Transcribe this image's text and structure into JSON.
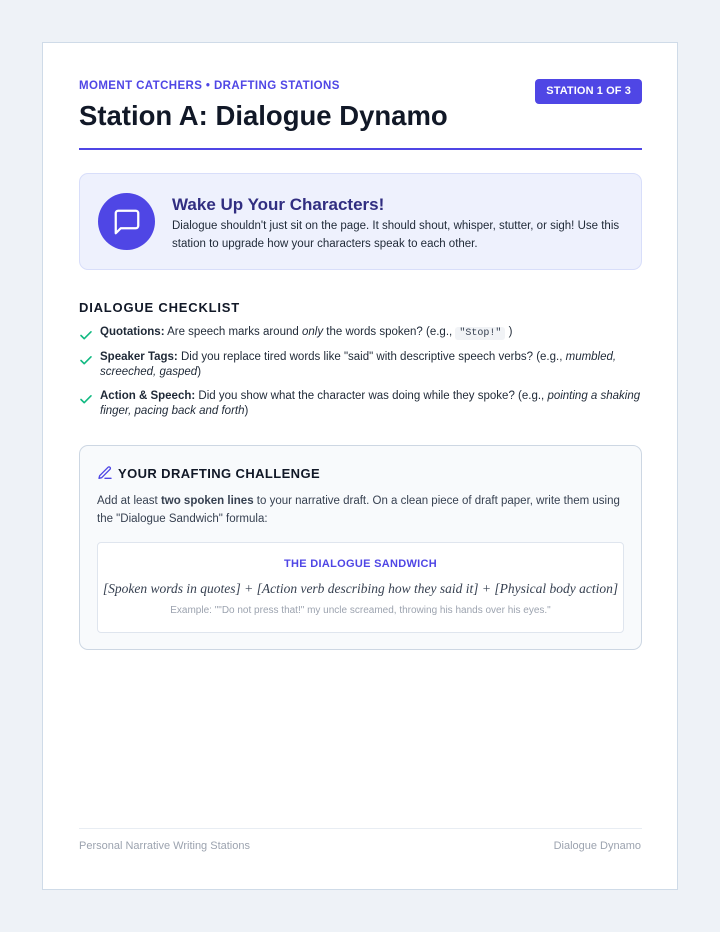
{
  "header": {
    "eyebrow": "MOMENT CATCHERS • DRAFTING STATIONS",
    "badge": "STATION 1 OF 3",
    "title": "Station A: Dialogue Dynamo"
  },
  "callout": {
    "icon": "speech-bubble-icon",
    "title": "Wake Up Your Characters!",
    "text": "Dialogue shouldn't just sit on the page. It should shout, whisper, stutter, or sigh! Use this station to upgrade how your characters speak to each other."
  },
  "checklist": {
    "heading": "DIALOGUE CHECKLIST",
    "items": [
      {
        "label": "Quotations:",
        "text_before": " Are speech marks around ",
        "emphasis": "only",
        "text_after": " the words spoken? (e.g., ",
        "code": "\"Stop!\"",
        "text_end": " )"
      },
      {
        "label": "Speaker Tags:",
        "text_before": " Did you replace tired words like \"said\" with descriptive speech verbs? (e.g., ",
        "emphasis": "mumbled, screeched, gasped",
        "text_after": ")"
      },
      {
        "label": "Action & Speech:",
        "text_before": " Did you show what the character was doing while they spoke? (e.g., ",
        "emphasis": "pointing a shaking finger, pacing back and forth",
        "text_after": ")"
      }
    ]
  },
  "challenge": {
    "icon": "pencil-icon",
    "title": "YOUR DRAFTING CHALLENGE",
    "text_before": "Add at least ",
    "text_bold": "two spoken lines",
    "text_after": " to your narrative draft. On a clean piece of draft paper, write them using the \"Dialogue Sandwich\" formula:",
    "sandwich": {
      "label": "THE DIALOGUE SANDWICH",
      "formula": "[Spoken words in quotes] + [Action verb describing how they said it] + [Physical body action]",
      "example": "Example: \"\"Do not press that!\" my uncle screamed, throwing his hands over his eyes.\""
    }
  },
  "footer": {
    "left": "Personal Narrative Writing Stations",
    "right": "Dialogue Dynamo"
  },
  "colors": {
    "accent": "#4f46e5",
    "callout_bg": "#eef1fd",
    "check": "#10b981"
  }
}
